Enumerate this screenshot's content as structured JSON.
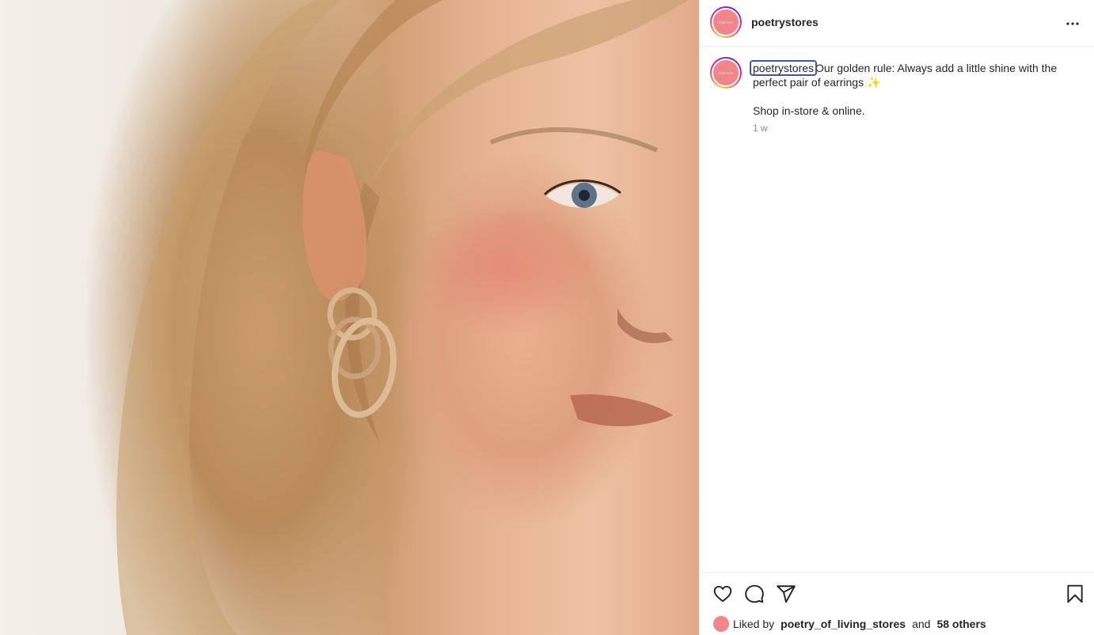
{
  "post": {
    "username": "poetrystores",
    "avatar_label": "POETRY",
    "caption_main": "Our golden rule: Always add a little shine with the perfect pair of earrings ✨",
    "caption_second": "Shop in-store & online.",
    "timestamp": "1 w"
  },
  "likes": {
    "prefix": "Liked by",
    "liker": "poetry_of_living_stores",
    "conjunction": "and",
    "others": "58 others"
  },
  "icons": {
    "more": "more-horizontal-icon",
    "like": "heart-icon",
    "comment": "comment-icon",
    "share": "paper-plane-icon",
    "save": "bookmark-icon"
  },
  "colors": {
    "accent_avatar": "#f2848c",
    "focus_outline": "#3b5b9a",
    "text": "#262626",
    "muted": "#8e8e8e"
  }
}
